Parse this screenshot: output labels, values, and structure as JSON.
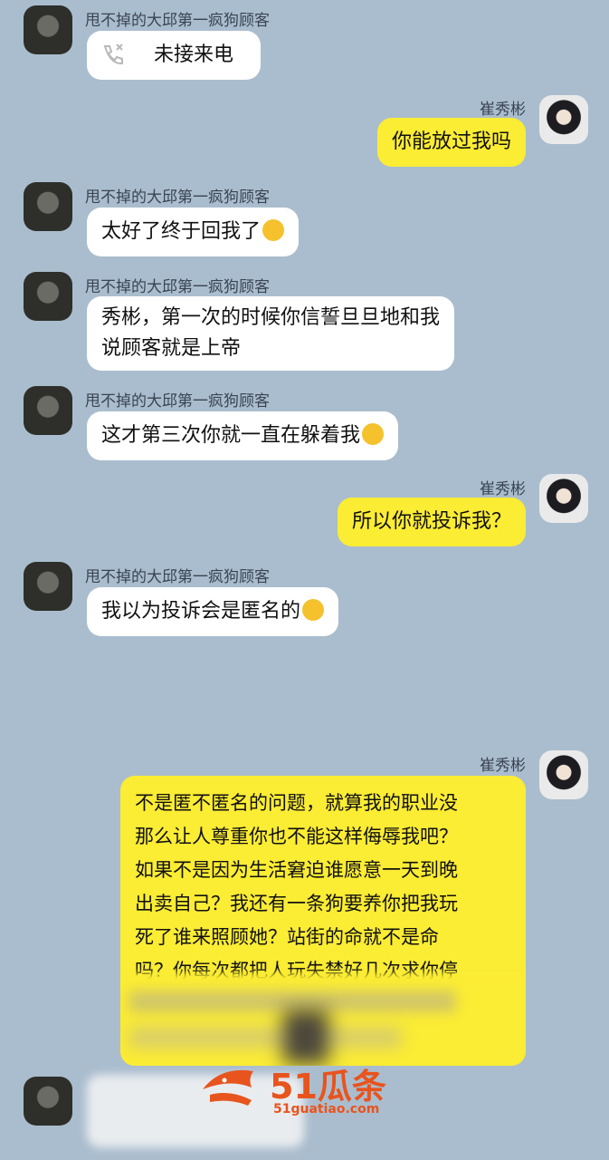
{
  "contact_name": "甩不掉的大邱第一疯狗顾客",
  "self_name": "崔秀彬",
  "messages": {
    "m1": "未接来电",
    "m2": "你能放过我吗",
    "m3": "太好了终于回我了",
    "m4_l1": "秀彬，第一次的时候你信誓旦旦地和我",
    "m4_l2": "说顾客就是上帝",
    "m5": "这才第三次你就一直在躲着我",
    "m6": "所以你就投诉我？",
    "m7": "我以为投诉会是匿名的",
    "m8_lines": [
      "不是匿不匿名的问题，就算我的职业没",
      "那么让人尊重你也不能这样侮辱我吧？",
      "如果不是因为生活窘迫谁愿意一天到晚",
      "出卖自己？我还有一条狗要养你把我玩",
      "死了谁来照顾她？站街的命就不是命",
      "吗？你每次都把人玩失禁好几次求你停"
    ]
  },
  "watermark": {
    "brand": "51瓜条",
    "url": "51guatiao.com"
  },
  "icons": {
    "missed_call": "phone-missed-icon",
    "emoji_cry": "loudly-crying-emoji-icon",
    "emoji_plead": "pleading-emoji-icon",
    "emoji_persevere": "persevering-emoji-icon"
  },
  "colors": {
    "background": "#aabdce",
    "incoming_bubble": "#ffffff",
    "outgoing_bubble": "#fbec34",
    "watermark": "#e8541e"
  }
}
